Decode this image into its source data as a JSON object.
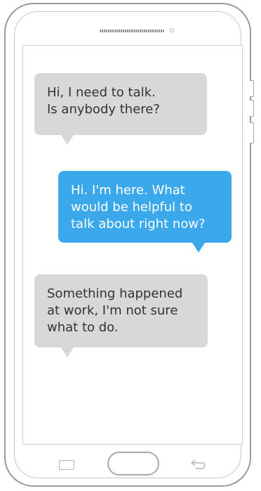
{
  "chat": {
    "messages": [
      {
        "sender": "user",
        "text": "Hi, I need to talk.\nIs anybody there?"
      },
      {
        "sender": "responder",
        "text": "Hi. I'm here. What would be helpful to talk about right now?"
      },
      {
        "sender": "user",
        "text": "Something happened at work, I'm not sure what to do."
      }
    ]
  },
  "colors": {
    "incoming_bubble": "#d8d8d8",
    "outgoing_bubble": "#3aa8ea"
  },
  "icons": {
    "recent_apps": "recent-apps-icon",
    "home": "home-button-icon",
    "back": "back-arrow-icon"
  }
}
